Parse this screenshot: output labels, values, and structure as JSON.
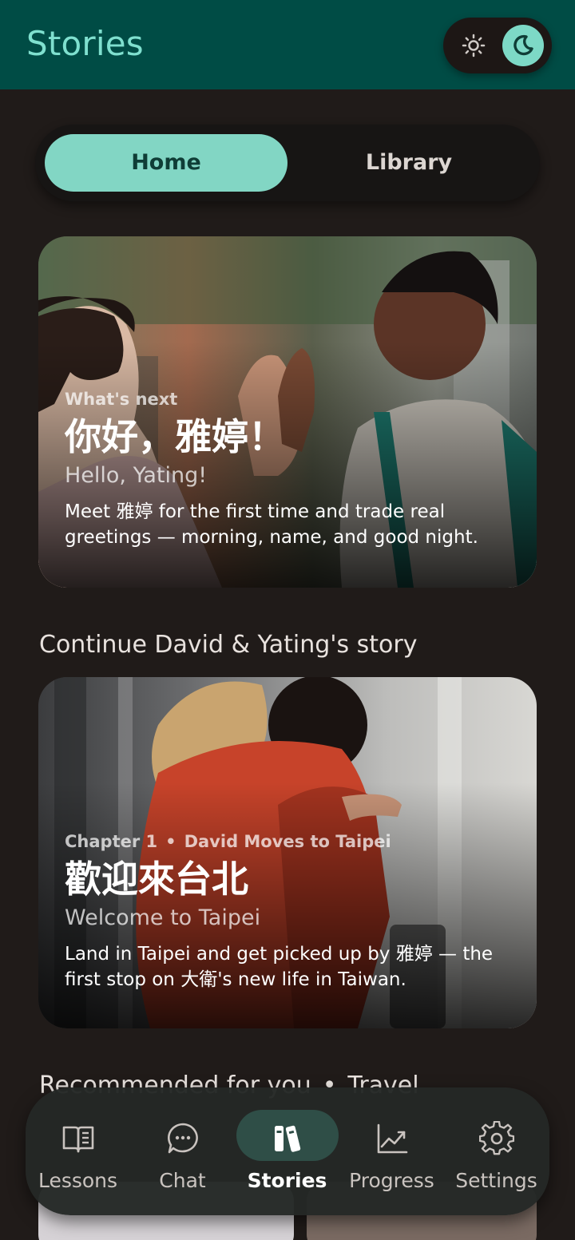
{
  "app": {
    "title": "Stories"
  },
  "theme_toggle": {
    "light_icon": "sun-icon",
    "dark_icon": "moon-icon",
    "selected": "dark"
  },
  "tabs": [
    {
      "label": "Home",
      "selected": true
    },
    {
      "label": "Library",
      "selected": false
    }
  ],
  "whats_next": {
    "eyebrow": "What's next",
    "headline": "你好，雅婷！",
    "subline": "Hello, Yating!",
    "description": "Meet 雅婷 for the first time and trade real greetings — morning, name, and good night."
  },
  "continue_section": {
    "title": "Continue David & Yating's story",
    "card": {
      "chapter": "Chapter 1",
      "separator": "•",
      "chapter_title": "David Moves to Taipei",
      "headline": "歡迎來台北",
      "subline": "Welcome to Taipei",
      "description": "Land in Taipei and get picked up by 雅婷 — the first stop on 大衛's new life in Taiwan."
    }
  },
  "recommended_section": {
    "title": "Recommended for you",
    "separator": "•",
    "category": "Travel"
  },
  "bottom_nav": {
    "items": [
      {
        "label": "Lessons",
        "icon": "open-book-icon",
        "active": false
      },
      {
        "label": "Chat",
        "icon": "chat-bubble-icon",
        "active": false
      },
      {
        "label": "Stories",
        "icon": "books-icon",
        "active": true
      },
      {
        "label": "Progress",
        "icon": "chart-line-icon",
        "active": false
      },
      {
        "label": "Settings",
        "icon": "gear-icon",
        "active": false
      }
    ]
  },
  "colors": {
    "app_bar": "#004c45",
    "accent": "#82d6c4",
    "background": "#201b19",
    "nav_active_pill": "#2f4e47"
  }
}
